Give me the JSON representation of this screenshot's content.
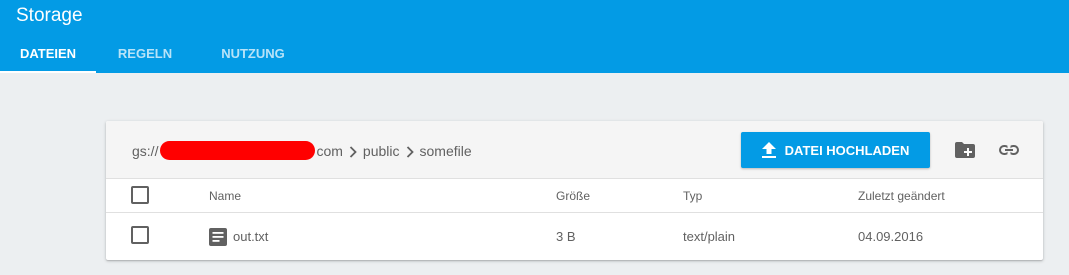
{
  "app": {
    "title": "Storage"
  },
  "tabs": [
    {
      "label": "DATEIEN",
      "active": true
    },
    {
      "label": "REGELN",
      "active": false
    },
    {
      "label": "NUTZUNG",
      "active": false
    }
  ],
  "breadcrumb": {
    "prefix": "gs://",
    "bucket_suffix": "com",
    "items": [
      "public",
      "somefile"
    ]
  },
  "toolbar": {
    "upload_label": "DATEI HOCHLADEN",
    "icons": [
      "upload-icon",
      "create-folder-icon",
      "link-icon"
    ]
  },
  "table": {
    "columns": [
      "Name",
      "Größe",
      "Typ",
      "Zuletzt geändert"
    ],
    "rows": [
      {
        "name": "out.txt",
        "size": "3 B",
        "type": "text/plain",
        "modified": "04.09.2016",
        "icon": "text-file-icon"
      }
    ]
  },
  "colors": {
    "accent": "#039be5",
    "redaction": "#ff0000",
    "background": "#eceff1"
  }
}
